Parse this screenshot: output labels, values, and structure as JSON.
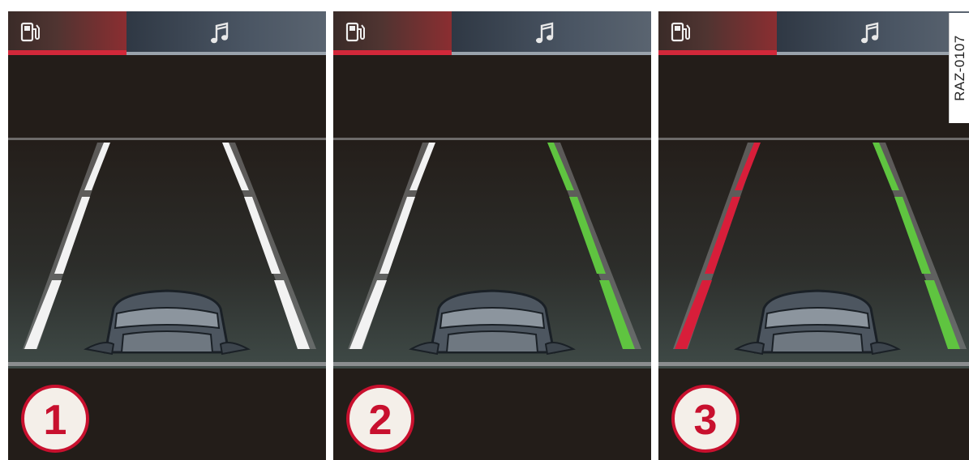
{
  "panels": [
    {
      "badge": "1",
      "left_lane_state": "inactive",
      "right_lane_state": "inactive"
    },
    {
      "badge": "2",
      "left_lane_state": "inactive",
      "right_lane_state": "active"
    },
    {
      "badge": "3",
      "left_lane_state": "warning",
      "right_lane_state": "active"
    }
  ],
  "icons": {
    "fuel": "fuel-pump-icon",
    "audio": "music-note-icon"
  },
  "colors": {
    "inactive_lane": "#f2f2f2",
    "active_lane": "#5fc440",
    "warning_lane": "#d81e3a",
    "badge": "#c8102e",
    "fuel_bar": "#d2283a"
  },
  "figure_code": "RAZ-0107"
}
